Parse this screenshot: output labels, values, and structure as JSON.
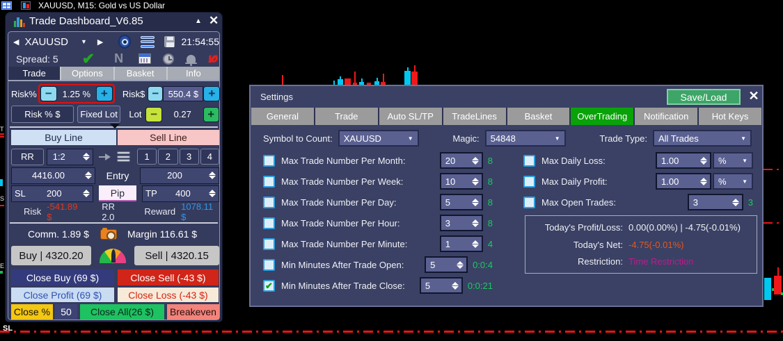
{
  "window": {
    "title": "XAUUSD, M15:  Gold vs US Dollar"
  },
  "panel": {
    "title": "Trade Dashboard_V6.85",
    "symbol": "XAUUSD",
    "clock": "21:54:55",
    "spread": "Spread: 5",
    "n_icon": "N",
    "tabs": [
      {
        "label": "Trade"
      },
      {
        "label": "Options"
      },
      {
        "label": "Basket"
      },
      {
        "label": "Info"
      }
    ],
    "risk_pct_label": "Risk%",
    "risk_pct_value": "1.25 %",
    "risk_usd_label": "Risk$",
    "risk_usd_value": "550.4 $",
    "risk_mode_button": "Risk % $",
    "fixed_lot_button": "Fixed Lot",
    "lot_label": "Lot",
    "lot_value": "0.27",
    "buy_line_tab": "Buy Line",
    "sell_line_tab": "Sell Line",
    "rr_button": "RR",
    "rr_value": "1:2",
    "preset_buttons": [
      "1",
      "2",
      "3",
      "4"
    ],
    "entry_price": "4416.00",
    "entry_label": "Entry",
    "entry_pips": "200",
    "sl_label": "SL",
    "sl_value": "200",
    "pip_button": "Pip",
    "tp_label": "TP",
    "tp_value": "400",
    "risk_label": "Risk",
    "risk_value": "-541.89 $",
    "rr_ratio": "RR 2.0",
    "reward_label": "Reward",
    "reward_value": "1078.11 $",
    "commission": "Comm. 1.89 $",
    "margin": "Margin 116.61 $",
    "buy_button": "Buy | 4320.20",
    "sell_button": "Sell | 4320.15",
    "close_buy_button": "Close Buy (69 $)",
    "close_sell_button": "Close Sell (-43 $)",
    "close_profit_button": "Close Profit (69 $)",
    "close_loss_button": "Close Loss (-43 $)",
    "close_pct_button": "Close %",
    "close_pct_value": "50",
    "close_all_button": "Close All(26 $)",
    "breakeven_button": "Breakeven"
  },
  "settings": {
    "title": "Settings",
    "save_load_button": "Save/Load",
    "tabs": [
      {
        "label": "General",
        "active": false
      },
      {
        "label": "Trade",
        "active": false
      },
      {
        "label": "Auto SL/TP",
        "active": false
      },
      {
        "label": "TradeLines",
        "active": false
      },
      {
        "label": "Basket",
        "active": false
      },
      {
        "label": "OverTrading",
        "active": true
      },
      {
        "label": "Notification",
        "active": false
      },
      {
        "label": "Hot Keys",
        "active": false
      }
    ],
    "symbol_label": "Symbol to Count:",
    "symbol_value": "XAUUSD",
    "magic_label": "Magic:",
    "magic_value": "54848",
    "trade_type_label": "Trade Type:",
    "trade_type_value": "All Trades",
    "left_rows": [
      {
        "check": "",
        "label": "Max Trade Number Per Month:",
        "value": "20",
        "info": "8"
      },
      {
        "check": "",
        "label": "Max Trade Number Per Week:",
        "value": "10",
        "info": "8"
      },
      {
        "check": "",
        "label": "Max Trade Number Per Day:",
        "value": "5",
        "info": "8"
      },
      {
        "check": "",
        "label": "Max Trade Number Per Hour:",
        "value": "3",
        "info": "8"
      },
      {
        "check": "",
        "label": "Max Trade Number Per Minute:",
        "value": "1",
        "info": "4"
      },
      {
        "check": "",
        "label": "Min Minutes After Trade Open:",
        "value": "5",
        "info": "0:0:4"
      },
      {
        "check": "✔",
        "label": "Min Minutes After Trade Close:",
        "value": "5",
        "info": "0:0:21"
      }
    ],
    "right_rows": [
      {
        "check": "",
        "label": "Max Daily Loss:",
        "value": "1.00",
        "unit": "%"
      },
      {
        "check": "",
        "label": "Max Daily Profit:",
        "value": "1.00",
        "unit": "%"
      },
      {
        "check": "",
        "label": "Max Open Trades:",
        "value": "3",
        "info": "3"
      }
    ],
    "today": {
      "pl_label": "Today's Profit/Loss:",
      "pl_value": "0.00(0.00%) | -4.75(-0.01%)",
      "net_label": "Today's Net:",
      "net_value": "-4.75(-0.01%)",
      "restriction_label": "Restriction:",
      "restriction_value": "Time Restriction"
    }
  },
  "chart": {
    "sl_marker": "SL"
  },
  "colors": {
    "overtrading_tab_green": "#09a209",
    "save_load_green": "#3da567",
    "counter_green": "#1acb5f",
    "loss_red": "#e0391c",
    "reward_blue": "#3096e8",
    "net_orange": "#e8561f",
    "restriction_magenta": "#bb1c8c",
    "candle_up_cyan": "#00c8f0",
    "candle_down_red": "#f01818"
  }
}
